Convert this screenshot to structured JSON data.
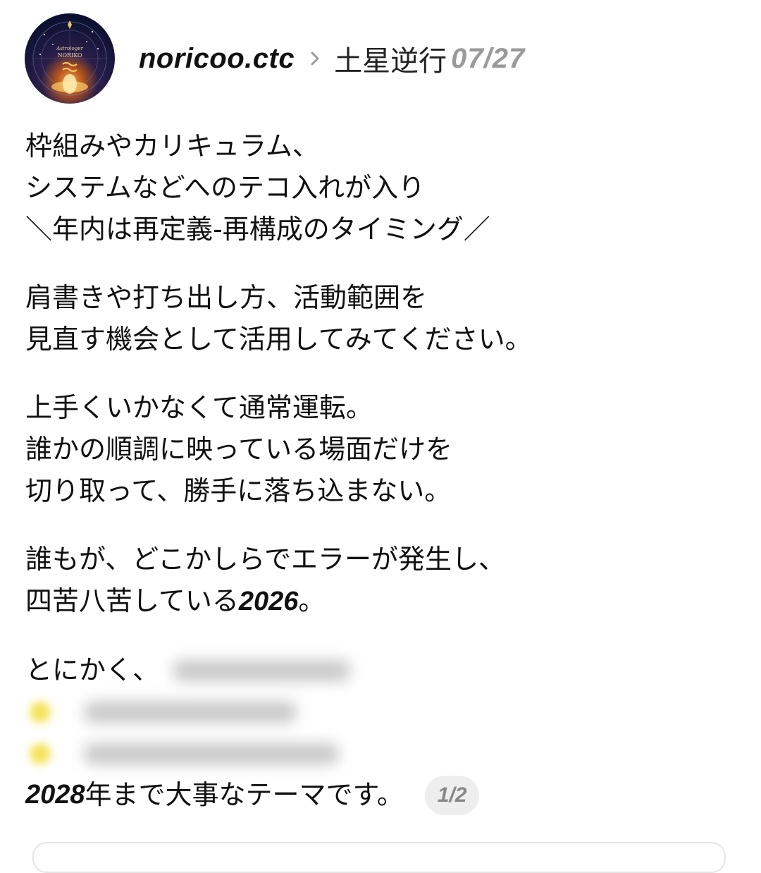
{
  "header": {
    "username": "noricoo.ctc",
    "topic": "土星逆行",
    "date": "07/27",
    "avatar_text": [
      "Astrologer",
      "NORIKO"
    ]
  },
  "body": {
    "paragraphs": [
      [
        "枠組みやカリキュラム、",
        "システムなどへのテコ入れが入り",
        "＼年内は再定義-再構成のタイミング／"
      ],
      [
        "肩書きや打ち出し方、活動範囲を",
        "見直す機会として活用してみてください。"
      ],
      [
        "上手くいかなくて通常運転。",
        "誰かの順調に映っている場面だけを",
        "切り取って、勝手に落ち込まない。"
      ],
      [
        "誰もが、どこかしらでエラーが発生し、"
      ]
    ],
    "p4_line2_prefix": "四苦八苦している",
    "p4_line2_year": "2026",
    "p4_line2_suffix": "。",
    "p5_line1_prefix": "とにかく、",
    "last_year": "2028",
    "last_suffix": "年まで大事なテーマです。"
  },
  "pager": {
    "label": "1/2"
  },
  "colors": {
    "text": "#111111",
    "muted": "#9a9a9a",
    "badge_bg": "#eeeeee",
    "highlight_dot": "#f5e35a"
  }
}
